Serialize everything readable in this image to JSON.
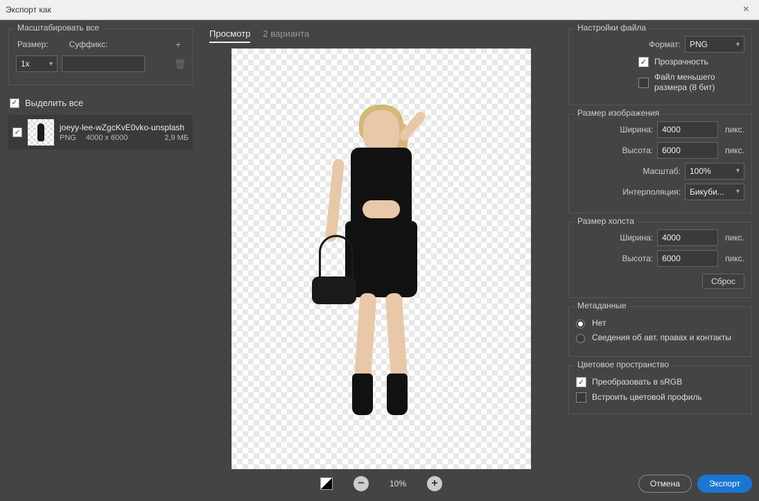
{
  "window": {
    "title": "Экспорт как"
  },
  "left": {
    "scale_all": "Масштабировать все",
    "size_label": "Размер:",
    "suffix_label": "Суффикс:",
    "size_value": "1x",
    "suffix_value": "",
    "select_all": "Выделить все",
    "file": {
      "name": "joeyy-lee-wZgcKvE0vko-unsplash",
      "format": "PNG",
      "dims": "4000 x 6000",
      "size": "2,9 МБ"
    }
  },
  "center": {
    "tab_preview": "Просмотр",
    "tab_variants": "2 варианта",
    "zoom_value": "10%"
  },
  "right": {
    "file_settings": "Настройки файла",
    "format_label": "Формат:",
    "format_value": "PNG",
    "transparency": "Прозрачность",
    "smaller_file": "Файл меньшего размера (8 бит)",
    "image_size": "Размер изображения",
    "width_label": "Ширина:",
    "height_label": "Высота:",
    "scale_label": "Масштаб:",
    "interp_label": "Интерполяция:",
    "width_value": "4000",
    "height_value": "6000",
    "scale_value": "100%",
    "interp_value": "Бикуби...",
    "unit": "пикс.",
    "canvas_size": "Размер холста",
    "canvas_width": "4000",
    "canvas_height": "6000",
    "reset": "Сброс",
    "metadata": "Метаданные",
    "meta_none": "Нет",
    "meta_copyright": "Сведения об авт. правах и контакты",
    "color_space": "Цветовое пространство",
    "convert_srgb": "Преобразовать в sRGB",
    "embed_profile": "Встроить цветовой профиль",
    "cancel": "Отмена",
    "export": "Экспорт"
  }
}
